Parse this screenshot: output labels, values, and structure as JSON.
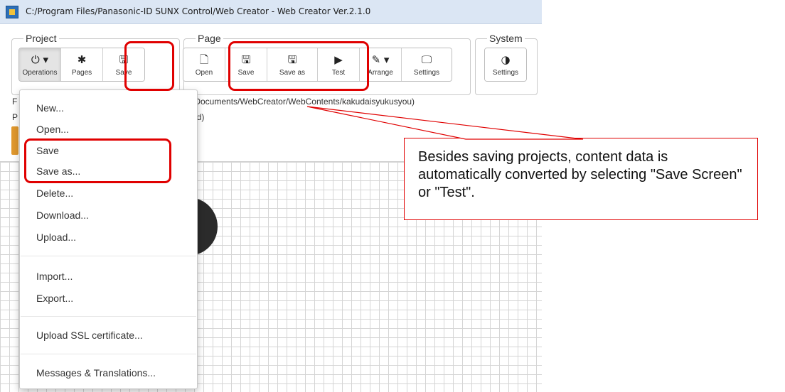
{
  "window": {
    "title": "C:/Program Files/Panasonic-ID SUNX Control/Web Creator - Web Creator Ver.2.1.0"
  },
  "groups": {
    "project": "Project",
    "page": "Page",
    "system": "System"
  },
  "project_buttons": [
    {
      "icon": "⏻ ▾",
      "label": "Operations"
    },
    {
      "icon": "✱",
      "label": "Pages"
    },
    {
      "icon": "🖫",
      "label": "Save"
    }
  ],
  "page_buttons": [
    {
      "icon": "🗋",
      "label": "Open"
    },
    {
      "icon": "🖫",
      "label": "Save"
    },
    {
      "icon": "🖫",
      "label": "Save as"
    },
    {
      "icon": "▶",
      "label": "Test"
    },
    {
      "icon": "✎ ▾",
      "label": "Arrange"
    },
    {
      "icon": "🖵",
      "label": "Settings"
    }
  ],
  "system_buttons": [
    {
      "icon": "◑",
      "label": "Settings"
    }
  ],
  "info": {
    "line1_prefix": "F",
    "line1": "/Documents/WebCreator/WebContents/kakudaisyukusyou)",
    "line2_prefix": "P",
    "line2": "ed)"
  },
  "menu": {
    "items": [
      "New...",
      "Open...",
      "Save",
      "Save as...",
      "Delete...",
      "Download...",
      "Upload...",
      "Import...",
      "Export...",
      "Upload SSL certificate...",
      "Messages & Translations..."
    ]
  },
  "annotation": {
    "callout": "Besides saving projects, content data is automatically converted by selecting \"Save Screen\" or \"Test\".",
    "highlight_color": "#e00000"
  }
}
